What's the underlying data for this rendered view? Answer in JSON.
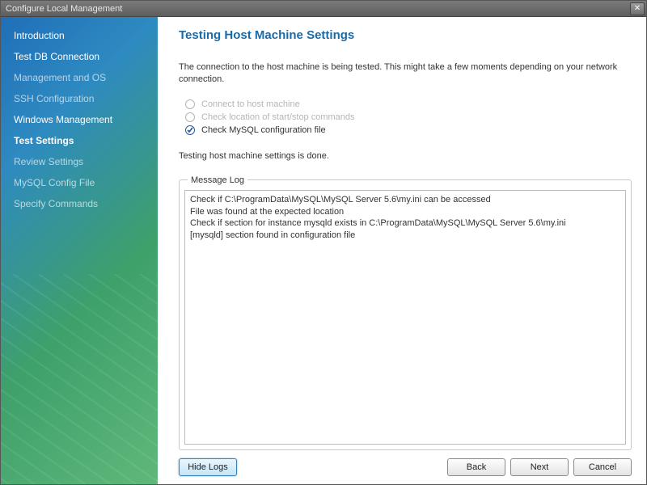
{
  "window": {
    "title": "Configure Local Management"
  },
  "sidebar": {
    "items": [
      {
        "label": "Introduction",
        "state": "active"
      },
      {
        "label": "Test DB Connection",
        "state": "active"
      },
      {
        "label": "Management and OS",
        "state": ""
      },
      {
        "label": "SSH Configuration",
        "state": ""
      },
      {
        "label": "Windows Management",
        "state": "active"
      },
      {
        "label": "Test Settings",
        "state": "current"
      },
      {
        "label": "Review Settings",
        "state": ""
      },
      {
        "label": "MySQL Config File",
        "state": ""
      },
      {
        "label": "Specify Commands",
        "state": ""
      }
    ]
  },
  "main": {
    "title": "Testing Host Machine Settings",
    "intro": "The connection to the host machine is being tested. This might take a few moments depending on your network connection.",
    "checks": [
      {
        "label": "Connect to host machine",
        "done": false
      },
      {
        "label": "Check location of start/stop commands",
        "done": false
      },
      {
        "label": "Check MySQL configuration file",
        "done": true
      }
    ],
    "status": "Testing host machine settings is done.",
    "log_legend": "Message Log",
    "log_lines": [
      "Check if C:\\ProgramData\\MySQL\\MySQL Server 5.6\\my.ini can be accessed",
      "File was found at the expected location",
      "Check if section for instance mysqld exists in C:\\ProgramData\\MySQL\\MySQL Server 5.6\\my.ini",
      "[mysqld] section found in configuration file"
    ]
  },
  "buttons": {
    "hide_logs": "Hide Logs",
    "back": "Back",
    "next": "Next",
    "cancel": "Cancel"
  }
}
